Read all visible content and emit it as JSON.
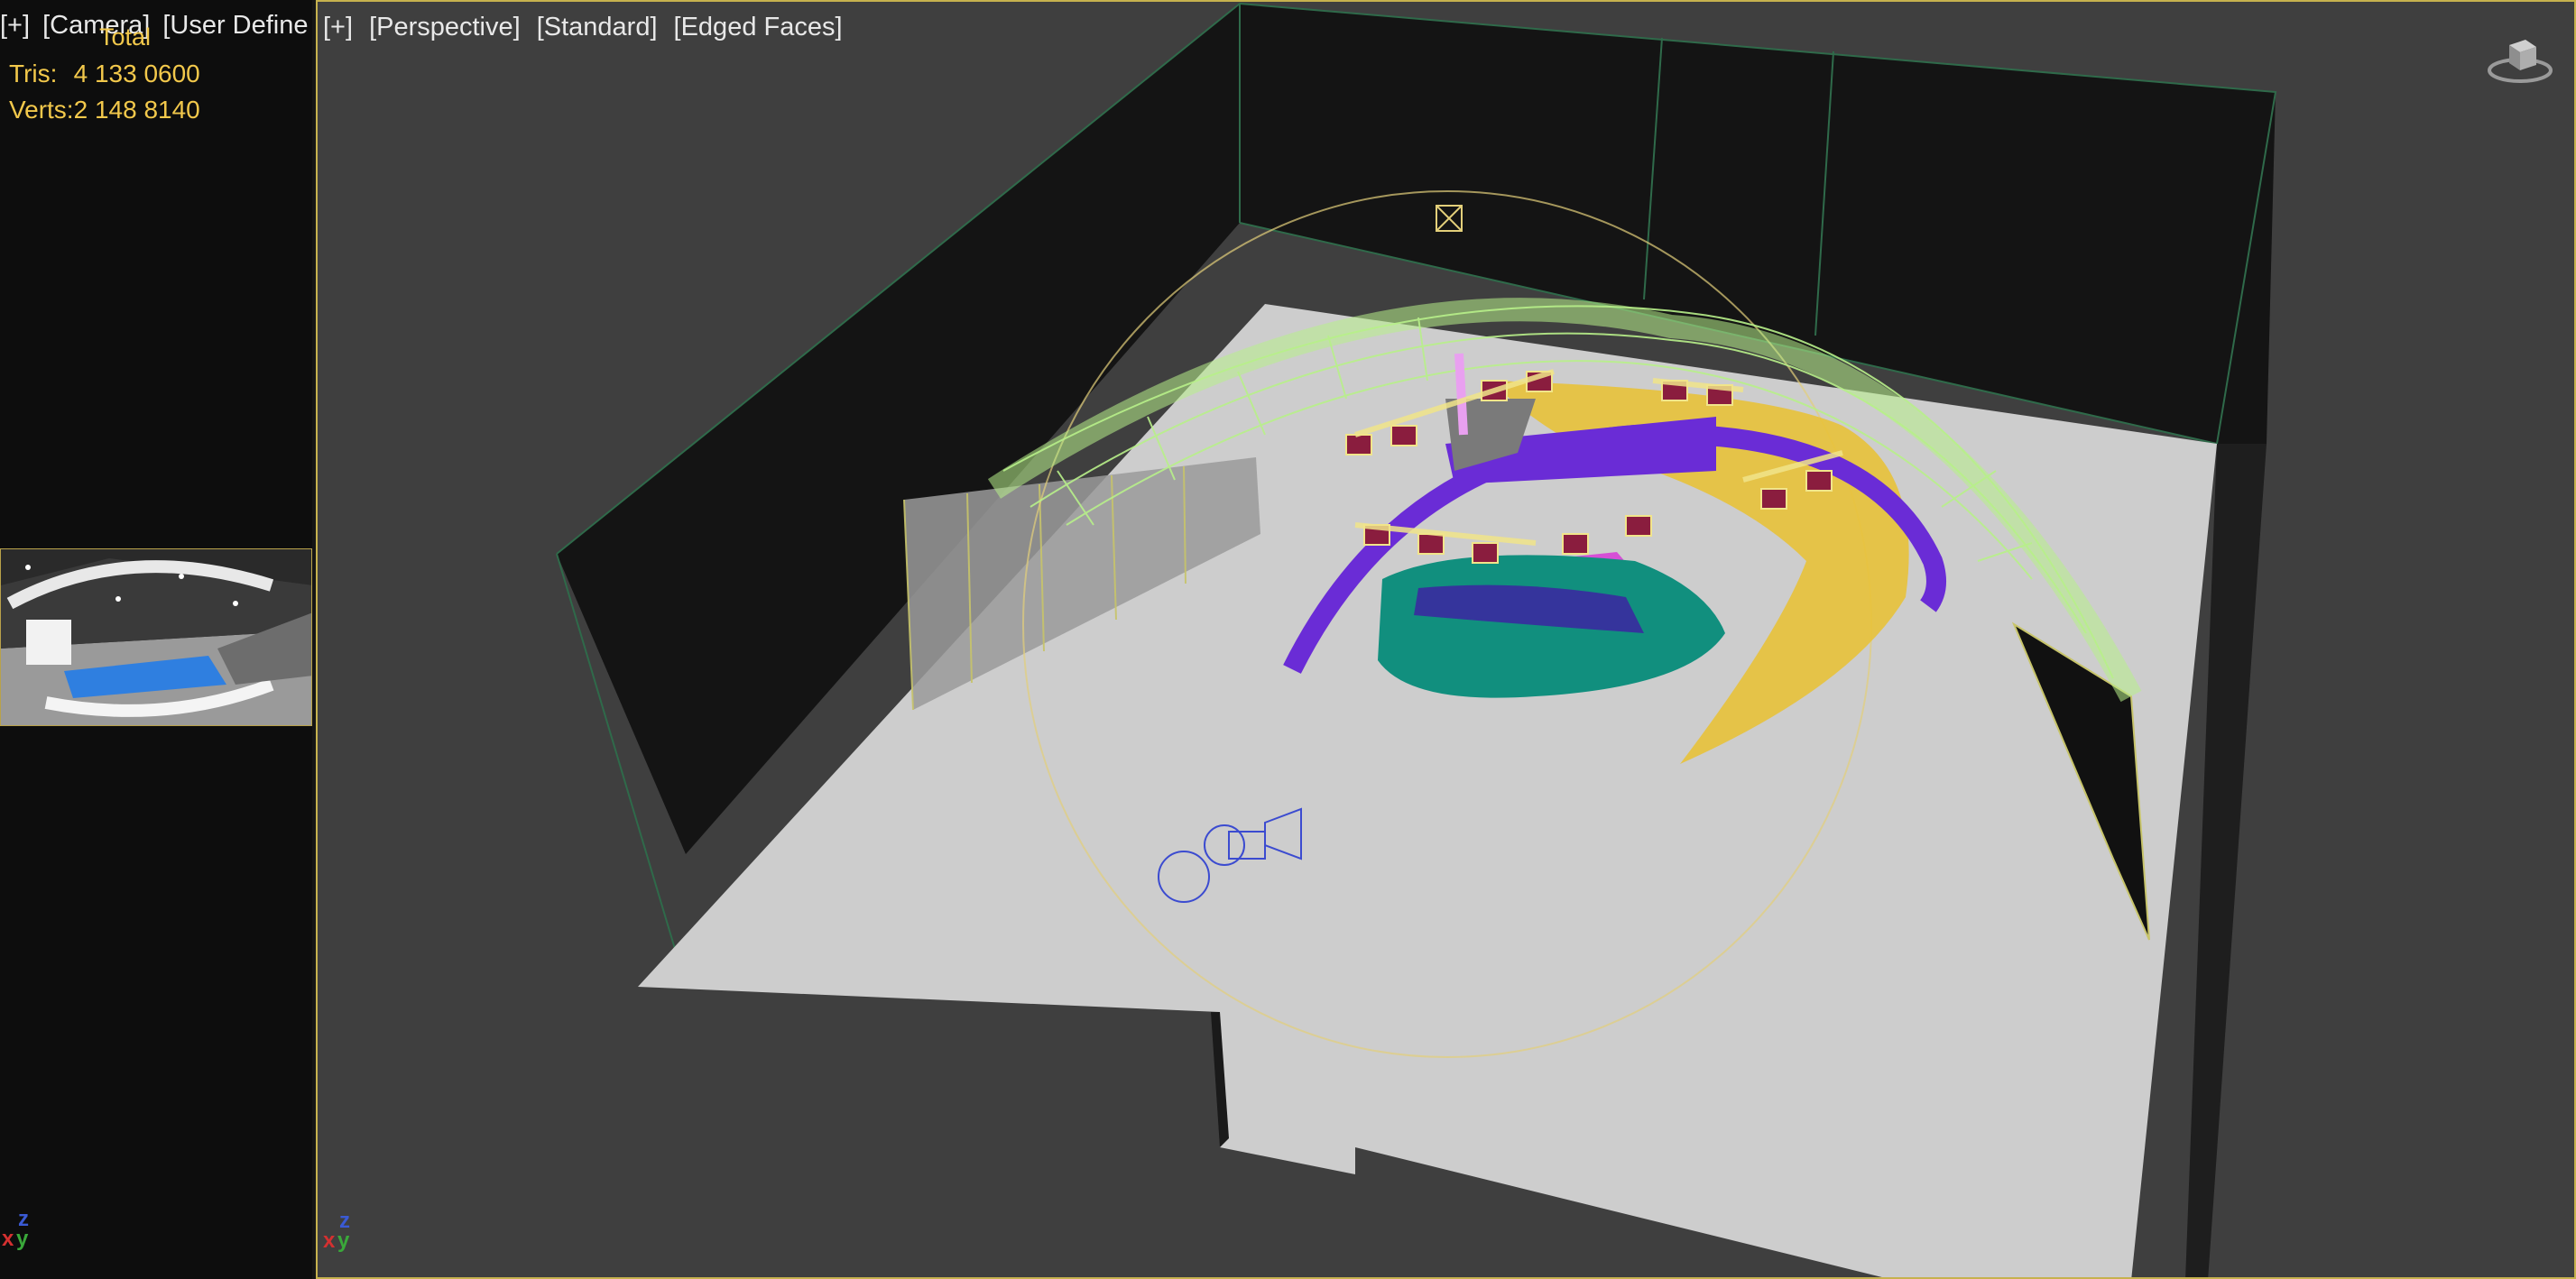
{
  "left_viewport": {
    "labels": [
      "[+]",
      "[Camera]",
      "[User Define"
    ],
    "stats": {
      "header": "Total",
      "rows": [
        {
          "label": "Tris:",
          "total": "4 133 060",
          "selected": "0"
        },
        {
          "label": "Verts:",
          "total": "2 148 814",
          "selected": "0"
        }
      ]
    },
    "axis": {
      "x": "x",
      "y": "y",
      "z": "z"
    }
  },
  "main_viewport": {
    "labels": [
      "[+]",
      "[Perspective]",
      "[Standard]",
      "[Edged Faces]"
    ],
    "axis": {
      "x": "x",
      "y": "y",
      "z": "z"
    },
    "viewcube_icon": "viewcube-icon"
  },
  "colors": {
    "stats_text": "#f2c84b",
    "active_border": "#c6b24e",
    "floor": "#cdcdcd",
    "walls": "#151515",
    "canopy_wire": "#b8f08a",
    "purple_arch": "#6a2cd6",
    "yellow_mesh": "#e8c23a",
    "teal_stage": "#118f7e",
    "magenta": "#d64fd6"
  }
}
